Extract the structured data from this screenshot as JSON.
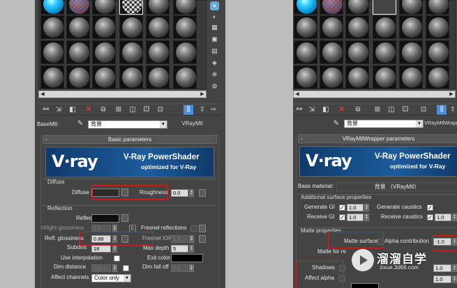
{
  "left": {
    "basemtl_label": "BaseMtl:",
    "basemtl_name": "背景",
    "basemtl_type": "VRayMtl",
    "rollout_title": "Basic parameters",
    "banner_brand": "v·ray",
    "banner_title": "V-Ray PowerShader",
    "banner_sub": "optimized for V-Ray",
    "diffuse_group": "Diffuse",
    "diffuse": "Diffuse",
    "roughness": "Roughness",
    "roughness_val": "0.0",
    "reflection_group": "Reflection",
    "reflect": "Reflect",
    "hilight": "Hilight glossiness",
    "hilight_val": "1.0",
    "l_btn": "L",
    "fresnel_refl": "Fresnel reflections",
    "refl_gloss": "Refl. glossiness",
    "refl_gloss_val": "0.88",
    "fresnel_ior": "Fresnel IOR",
    "fresnel_ior_val": "1.6",
    "subdivs": "Subdivs",
    "subdivs_val": "18",
    "max_depth": "Max depth",
    "max_depth_val": "5",
    "use_interp": "Use interpolation",
    "exit_color": "Exit color",
    "dim_distance": "Dim distance",
    "dim_distance_val": "100.0",
    "dim_falloff": "Dim fall off",
    "dim_falloff_val": "0.0",
    "affect_channels": "Affect channels",
    "affect_channels_val": "Color only"
  },
  "right": {
    "basemtl_name": "背景",
    "basemtl_type": "VRayMtlWrapper",
    "rollout_title": "VRayMtlWrapper parameters",
    "banner_brand": "v·ray",
    "banner_title": "V-Ray PowerShader",
    "banner_sub": "optimized for V-Ray",
    "base_material": "Base material:",
    "base_material_val": "背景 （VRayMtl）",
    "additional": "Additional surface properties",
    "generate_gi": "Generate GI",
    "generate_gi_val": "1.0",
    "generate_caustics": "Generate caustics",
    "receive_gi": "Receive GI",
    "receive_gi_val": "1.0",
    "receive_caustics": "Receive caustics",
    "receive_caustics_val": "1.0",
    "matte_group": "Matte properties",
    "matte_surface": "Matte surface",
    "alpha_contribution": "Alpha contribution",
    "alpha_contribution_val": "-1.0",
    "matte_for_refl": "Matte for re",
    "shadows": "Shadows",
    "affect_alpha": "Affect alpha",
    "val_10": "1.0"
  },
  "watermark": {
    "name": "溜溜自学",
    "url": "zixue.3d66.com"
  }
}
